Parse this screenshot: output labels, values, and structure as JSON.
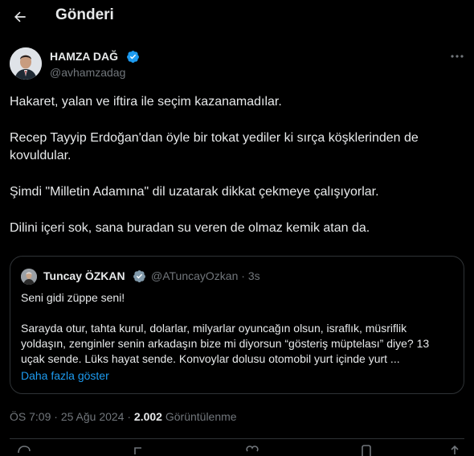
{
  "header": {
    "title": "Gönderi",
    "back_icon": "arrow-left-icon"
  },
  "author": {
    "name": "HAMZA DAĞ",
    "handle": "@avhamzadag",
    "verified": true
  },
  "tweet": {
    "paragraphs": [
      "Hakaret, yalan ve iftira ile seçim kazanamadılar.",
      "Recep Tayyip Erdoğan'dan öyle bir tokat yediler ki sırça köşklerinden de kovuldular.",
      "Şimdi \"Milletin Adamına\" dil uzatarak dikkat çekmeye çalışıyorlar.",
      "Dilini içeri sok, sana buradan su veren de olmaz kemik atan da."
    ]
  },
  "quote": {
    "name": "Tuncay ÖZKAN",
    "handle": "@ATuncayOzkan",
    "separator": "·",
    "time": "3s",
    "paragraphs": [
      "Seni gidi züppe seni!",
      "Sarayda otur, tahta kurul, dolarlar, milyarlar oyuncağın olsun, israflık, müsriflik yoldaşın, zenginler senin arkadaşın bize mi diyorsun “gösteriş müptelası” diye? 13 uçak sende. Lüks hayat sende. Konvoylar dolusu otomobil yurt içinde yurt ..."
    ],
    "show_more": "Daha fazla göster"
  },
  "meta": {
    "time": "ÖS 7:09",
    "separator": "·",
    "date": "25 Ağu 2024",
    "views_count": "2.002",
    "views_label": "Görüntülenme"
  },
  "colors": {
    "background": "#000000",
    "text": "#e7e9ea",
    "muted": "#71767b",
    "accent": "#1d9bf0",
    "border": "#2f3336"
  }
}
